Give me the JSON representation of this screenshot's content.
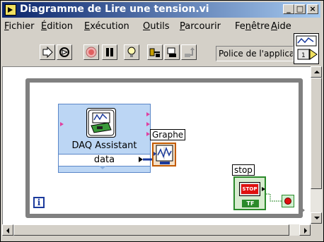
{
  "window": {
    "title": "Diagramme de Lire une tension.vi"
  },
  "title_buttons": {
    "minimize": "_",
    "maximize": "□",
    "close": "×"
  },
  "menu": [
    {
      "label": "Fichier",
      "accel": "F",
      "rest": "ichier"
    },
    {
      "label": "Édition",
      "accel": "É",
      "rest": "dition"
    },
    {
      "label": "Exécution",
      "accel": "E",
      "rest": "xécution"
    },
    {
      "label": "Outils",
      "accel": "O",
      "rest": "utils"
    },
    {
      "label": "Parcourir",
      "accel": "P",
      "rest": "arcourir"
    },
    {
      "label": "Fenêtre",
      "pre": "Fe",
      "accel": "n",
      "rest": "être"
    },
    {
      "label": "Aide",
      "accel": "A",
      "rest": "ide"
    }
  ],
  "toolbar": {
    "font_select": "Police de l'application",
    "icons": [
      "run-arrow-icon",
      "run-continuously-icon",
      "abort-icon",
      "pause-icon",
      "highlight-execution-icon",
      "retain-wire-values-icon",
      "step-into-icon",
      "step-out-icon"
    ]
  },
  "connector_icon": {
    "number": "1"
  },
  "diagram": {
    "daq_assistant": {
      "label": "DAQ Assistant",
      "terminal": "data"
    },
    "graph": {
      "label": "Graphe"
    },
    "stop": {
      "label": "stop",
      "button_text": "STOP",
      "type_text": "TF"
    },
    "iteration_terminal": "i"
  },
  "colors": {
    "title_start": "#0a246a",
    "title_end": "#a6caf0",
    "dynamic_wire": "#1b3a9c",
    "boolean_wire": "#2a8a2a",
    "loop_border": "#808080"
  }
}
